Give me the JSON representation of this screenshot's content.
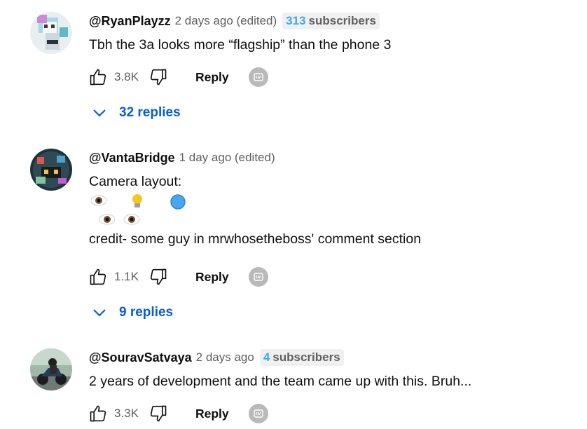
{
  "comments": [
    {
      "author": "@RyanPlayzz",
      "time": "2 days ago (edited)",
      "subscribers_count": "313",
      "subscribers_label": "subscribers",
      "text_lines": [
        "Tbh the 3a looks more “flagship” than the phone 3"
      ],
      "likes": "3.8K",
      "reply_label": "Reply",
      "replies_label": "32 replies"
    },
    {
      "author": "@VantaBridge",
      "time": "1 day ago (edited)",
      "text_lines": [
        "Camera layout:",
        "credit- some guy in mrwhosetheboss' comment section"
      ],
      "emoji_rows": [
        [
          "👁️",
          "💡",
          "🔵"
        ],
        [
          "👁️",
          "👁️"
        ]
      ],
      "likes": "1.1K",
      "reply_label": "Reply",
      "replies_label": "9 replies"
    },
    {
      "author": "@SouravSatvaya",
      "time": "2 days ago",
      "subscribers_count": "4",
      "subscribers_label": "subscribers",
      "text_lines": [
        "2 years of development and the team came up with this. Bruh..."
      ],
      "likes": "3.3K",
      "reply_label": "Reply"
    }
  ],
  "icons": {
    "like": "thumbs-up-outline-icon",
    "dislike": "thumbs-down-outline-icon",
    "creator": "creator-heart-icon",
    "expand": "chevron-down-icon"
  },
  "colors": {
    "link_blue": "#065fd4",
    "subscriber_count_blue": "#3ea6ff",
    "secondary_text": "#606060"
  }
}
